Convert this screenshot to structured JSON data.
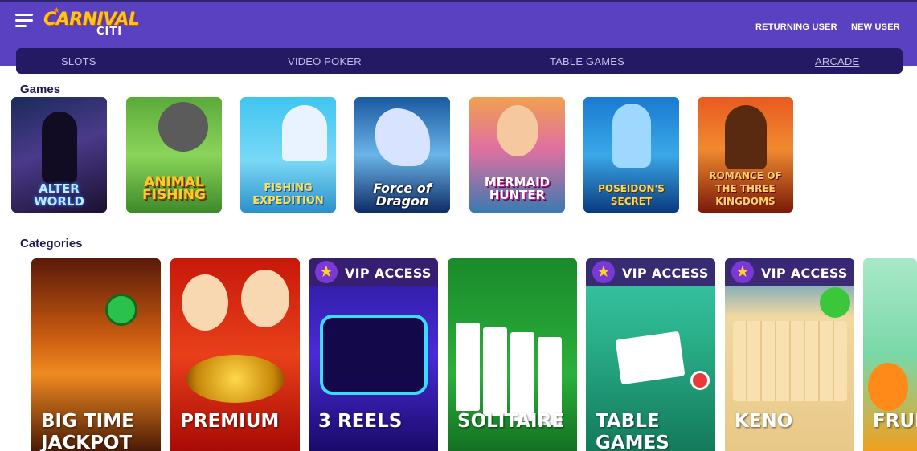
{
  "header": {
    "logo_main": "CARNIVAL",
    "logo_sub": "CITI",
    "returning_user": "RETURNING USER",
    "new_user": "NEW USER"
  },
  "nav": {
    "items": [
      "SLOTS",
      "VIDEO POKER",
      "TABLE GAMES",
      "ARCADE"
    ],
    "active": "ARCADE"
  },
  "games": {
    "title": "Games",
    "items": [
      {
        "label": "ALTER WORLD"
      },
      {
        "label": "ANIMAL FISHING"
      },
      {
        "label": "FISHING EXPEDITION"
      },
      {
        "label": "Force of Dragon"
      },
      {
        "label": "MERMAID HUNTER"
      },
      {
        "label": "POSEIDON'S SECRET"
      },
      {
        "label": "ROMANCE OF THE THREE KINGDOMS"
      }
    ]
  },
  "categories": {
    "title": "Categories",
    "vip_label": "VIP ACCESS",
    "items": [
      {
        "label": "BIG TIME JACKPOT",
        "vip": false
      },
      {
        "label": "PREMIUM",
        "vip": false
      },
      {
        "label": "3 REELS",
        "vip": true
      },
      {
        "label": "SOLITAIRE",
        "vip": false
      },
      {
        "label": "TABLE GAMES",
        "vip": true
      },
      {
        "label": "KENO",
        "vip": true
      },
      {
        "label": "FRUIT",
        "vip": false
      }
    ]
  },
  "colors": {
    "header_bg": "#5a41c2",
    "nav_bg": "#231a63",
    "section_title": "#1e1a4a",
    "vip_badge": "#371e6e"
  }
}
